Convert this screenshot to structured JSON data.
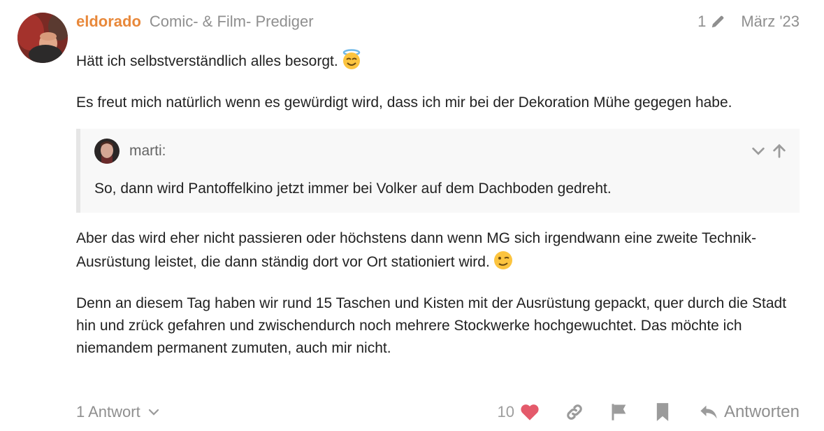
{
  "post": {
    "username": "eldorado",
    "user_title": "Comic- & Film- Prediger",
    "edit_count": "1",
    "date": "März '23",
    "paragraph1": "Hätt ich selbstverständlich alles besorgt.",
    "paragraph1_emoji": "innocent-emoji",
    "paragraph2": "Es freut mich natürlich wenn es gewürdigt wird, dass ich mir bei der Dekoration Mühe gegegen habe.",
    "quote": {
      "author": "marti:",
      "text": "So, dann wird Pantoffelkino jetzt immer bei Volker auf dem Dachboden gedreht."
    },
    "paragraph3": "Aber das wird eher nicht passieren oder höchstens dann wenn MG sich irgendwann eine zweite Technik-Ausrüstung leistet, die dann ständig dort vor Ort stationiert wird.",
    "paragraph3_emoji": "wink-emoji",
    "paragraph4": "Denn an diesem Tag haben wir rund 15 Taschen und Kisten mit der Ausrüstung gepackt, quer durch die Stadt hin und zrück gefahren und zwischendurch noch mehrere Stockwerke hochgewuchtet. Das möchte ich niemandem permanent zumuten, auch mir nicht."
  },
  "menu": {
    "replies_label": "1 Antwort",
    "like_count": "10",
    "reply_label": "Antworten"
  },
  "colors": {
    "username": "#e8883a",
    "muted": "#8f8f8f",
    "like": "#e45a6b",
    "quote_bg": "#f8f8f8",
    "quote_border": "#e6e6e6"
  }
}
